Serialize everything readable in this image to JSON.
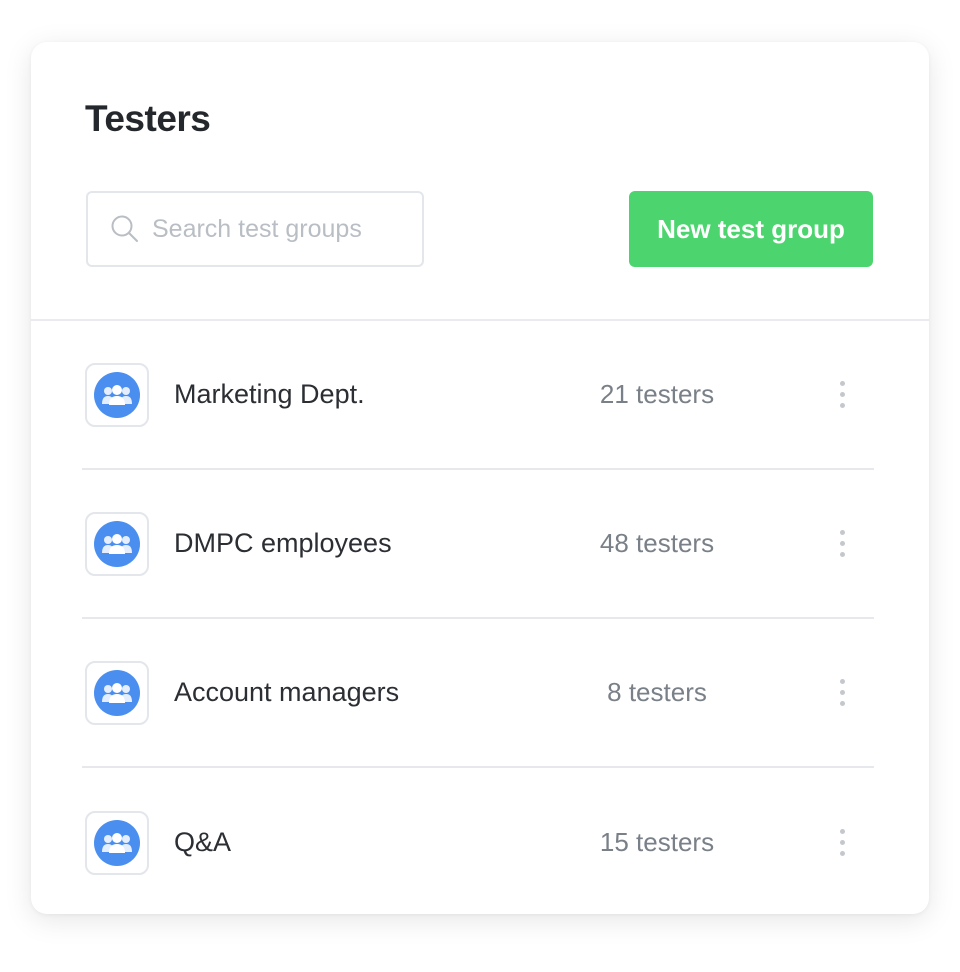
{
  "title": "Testers",
  "search": {
    "placeholder": "Search test groups",
    "value": ""
  },
  "new_button_label": "New test group",
  "colors": {
    "accent_green": "#4cd56e",
    "avatar_blue": "#4a8ff0"
  },
  "groups": [
    {
      "name": "Marketing Dept.",
      "count": "21 testers",
      "icon": "group-icon"
    },
    {
      "name": "DMPC employees",
      "count": "48 testers",
      "icon": "group-icon"
    },
    {
      "name": "Account managers",
      "count": "8 testers",
      "icon": "group-icon"
    },
    {
      "name": "Q&A",
      "count": "15 testers",
      "icon": "group-icon"
    }
  ]
}
